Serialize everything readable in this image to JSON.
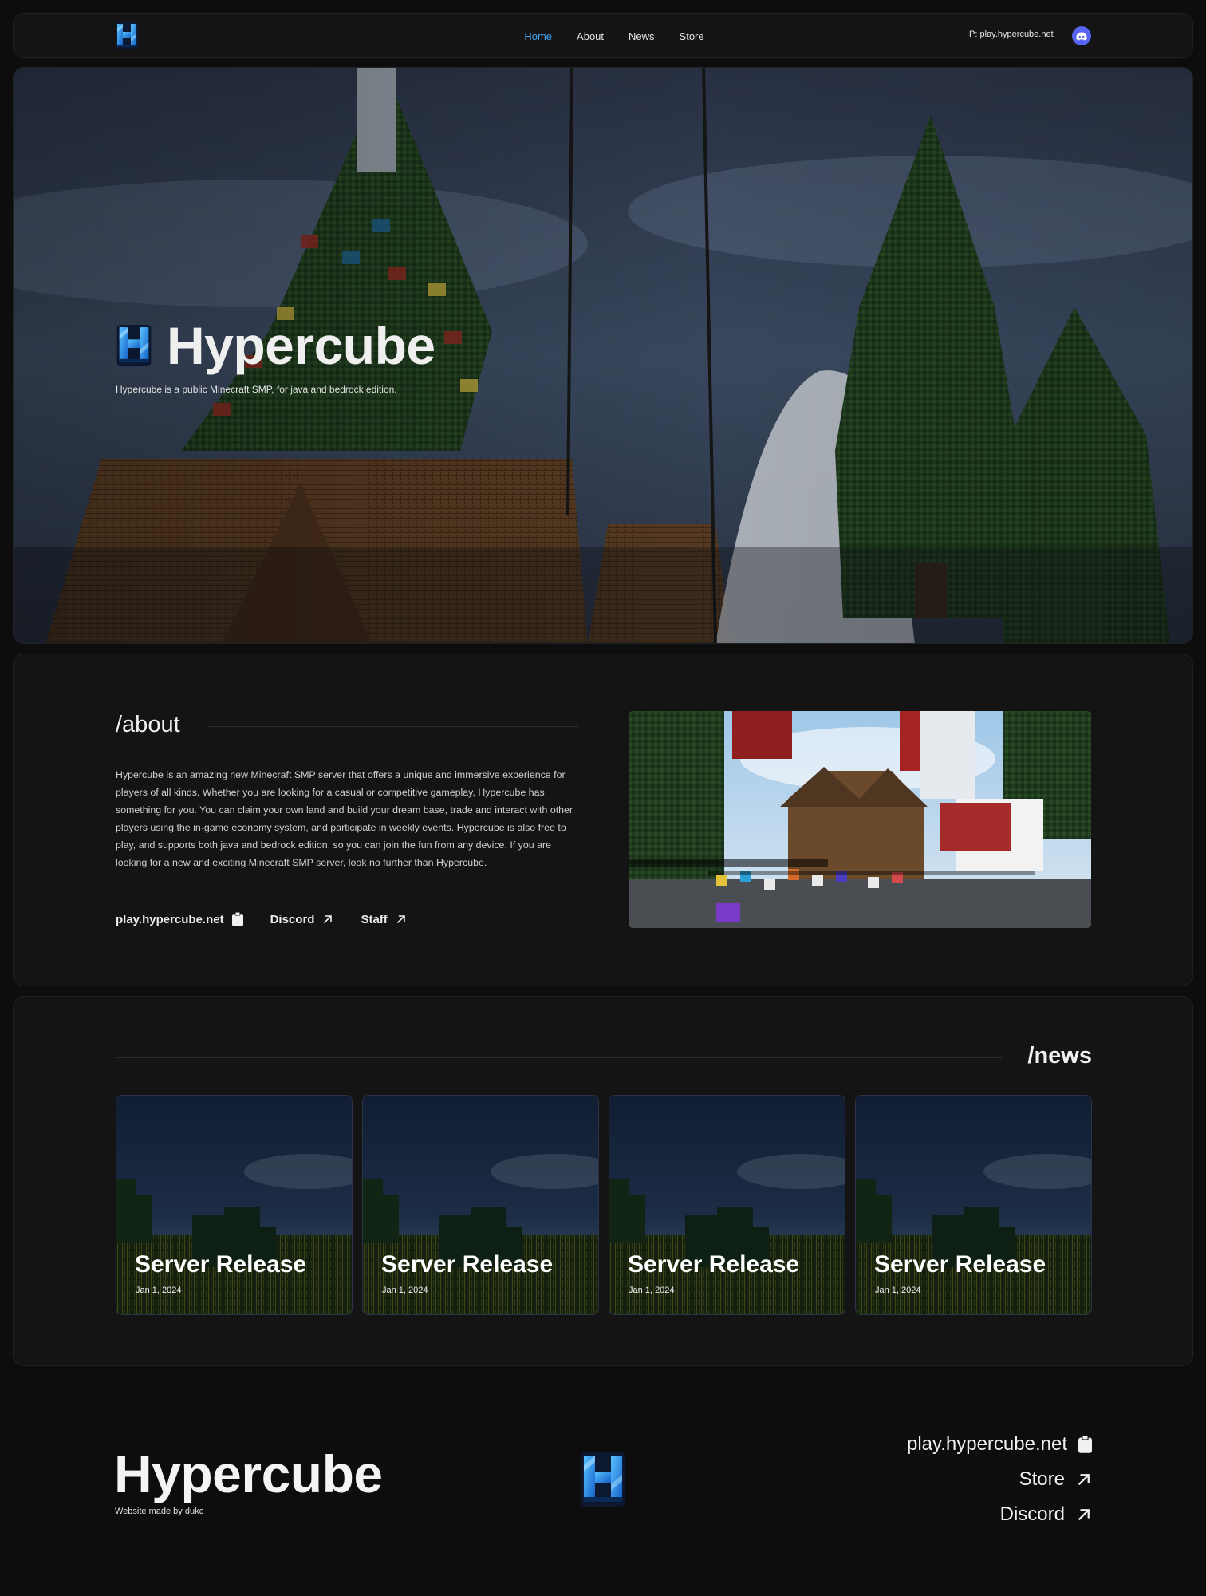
{
  "nav": {
    "logo_icon": "hypercube-logo-icon",
    "links": [
      "Home",
      "About",
      "News",
      "Store"
    ],
    "active_link": "Home",
    "ip_label": "IP: play.hypercube.net",
    "discord_icon": "discord-icon",
    "accent_color": "#42a3ee",
    "discord_color": "#5865f2"
  },
  "hero": {
    "title": "Hypercube",
    "subtitle": "Hypercube is a public Minecraft SMP, for java and bedrock edition."
  },
  "about": {
    "heading": "/about",
    "body": "Hypercube is an amazing new Minecraft SMP server that offers a unique and immersive experience for players of all kinds. Whether you are looking for a casual or competitive gameplay, Hypercube has something for you. You can claim your own land and build your dream base, trade and interact with other players using the in-game economy system, and participate in weekly events. Hypercube is also free to play, and supports both java and bedrock edition, so you can join the fun from any device. If you are looking for a new and exciting Minecraft SMP server, look no further than Hypercube.",
    "links": [
      {
        "label": "play.hypercube.net",
        "icon": "clipboard-icon"
      },
      {
        "label": "Discord",
        "icon": "arrow-up-right-icon"
      },
      {
        "label": "Staff",
        "icon": "arrow-up-right-icon"
      }
    ]
  },
  "news": {
    "heading": "/news",
    "items": [
      {
        "title": "Server Release",
        "date": "Jan 1, 2024"
      },
      {
        "title": "Server Release",
        "date": "Jan 1, 2024"
      },
      {
        "title": "Server Release",
        "date": "Jan 1, 2024"
      },
      {
        "title": "Server Release",
        "date": "Jan 1, 2024"
      }
    ]
  },
  "footer": {
    "title": "Hypercube",
    "credit": "Website made by dukc",
    "links": [
      {
        "label": "play.hypercube.net",
        "icon": "clipboard-icon"
      },
      {
        "label": "Store",
        "icon": "arrow-up-right-icon"
      },
      {
        "label": "Discord",
        "icon": "arrow-up-right-icon"
      }
    ]
  }
}
